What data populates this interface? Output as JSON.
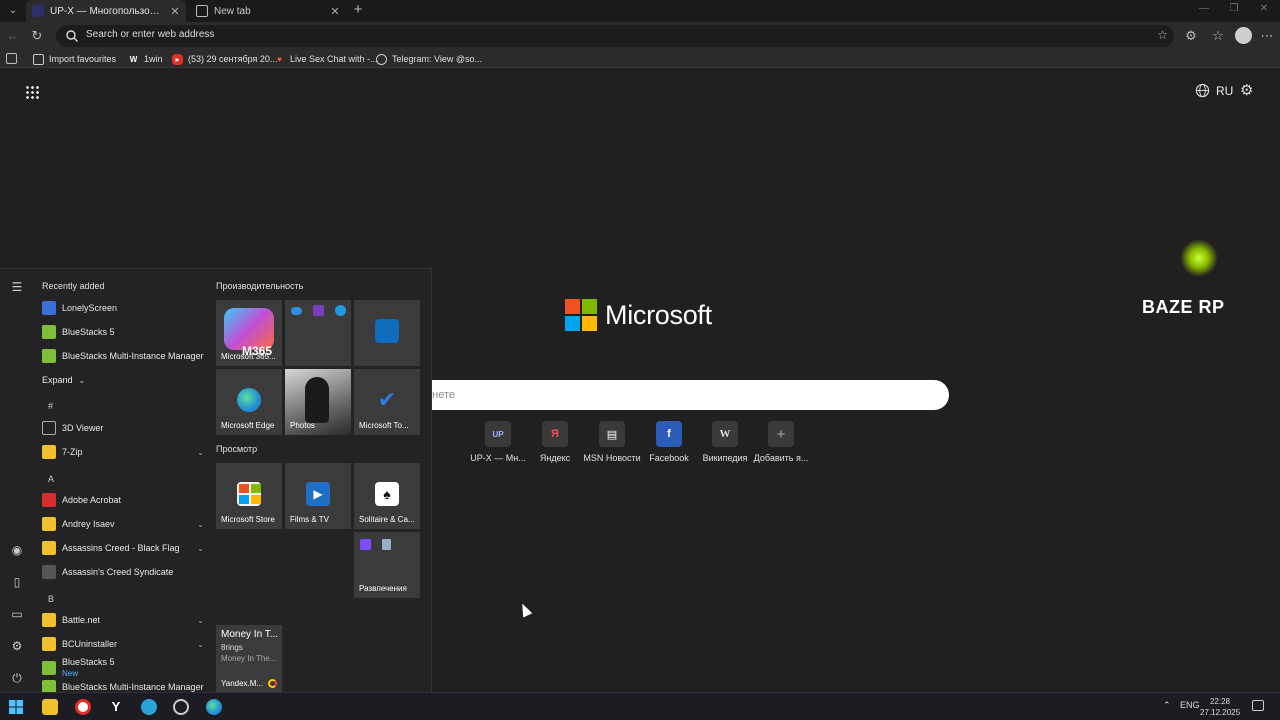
{
  "browser": {
    "tabs": [
      {
        "title": "UP-X — Многопользовательская",
        "favicon": "upx-icon",
        "active": true
      },
      {
        "title": "New tab",
        "favicon": "newtab-icon",
        "active": false
      }
    ],
    "address_placeholder": "Search or enter web address",
    "bookmarks": [
      {
        "label": "Import favourites",
        "icon": "import-icon"
      },
      {
        "label": "1win",
        "icon": "1win-icon"
      },
      {
        "label": "(53) 29 сентября 20...",
        "icon": "youtube-icon"
      },
      {
        "label": "Live Sex Chat with -...",
        "icon": "heart-icon"
      },
      {
        "label": "Telegram: View @so...",
        "icon": "globe-icon"
      }
    ]
  },
  "ntp": {
    "language": "RU",
    "brand": "Microsoft",
    "search_placeholder": "рнете",
    "quick_links": [
      {
        "label": "UP-X — Мн...",
        "glyph": "UP"
      },
      {
        "label": "Яндекс",
        "glyph": "Я"
      },
      {
        "label": "MSN Новости",
        "glyph": "▤"
      },
      {
        "label": "Facebook",
        "glyph": "f"
      },
      {
        "label": "Википедия",
        "glyph": "W"
      },
      {
        "label": "Добавить я...",
        "glyph": "+"
      }
    ],
    "baze_text": "BAZE RP"
  },
  "start_menu": {
    "recently_added_title": "Recently added",
    "recent": [
      {
        "label": "LonelyScreen",
        "color": "#3a6fd8"
      },
      {
        "label": "BlueStacks 5",
        "color": "#7fbf3a"
      },
      {
        "label": "BlueStacks Multi-Instance Manager",
        "color": "#7fbf3a"
      }
    ],
    "expand_label": "Expand",
    "apps": [
      {
        "kind": "letter",
        "label": "#"
      },
      {
        "kind": "app",
        "label": "3D Viewer",
        "color": "#9aa0a6",
        "chev": false
      },
      {
        "kind": "app",
        "label": "7-Zip",
        "color": "#f0c030",
        "chev": true
      },
      {
        "kind": "letter",
        "label": "A"
      },
      {
        "kind": "app",
        "label": "Adobe Acrobat",
        "color": "#d32f2f",
        "chev": false
      },
      {
        "kind": "app",
        "label": "Andrey Isaev",
        "color": "#f0c030",
        "chev": true
      },
      {
        "kind": "app",
        "label": "Assassins Creed - Black Flag",
        "color": "#f0c030",
        "chev": true
      },
      {
        "kind": "app",
        "label": "Assassin's Creed Syndicate",
        "color": "#555555",
        "chev": false
      },
      {
        "kind": "letter",
        "label": "B"
      },
      {
        "kind": "app",
        "label": "Battle.net",
        "color": "#f0c030",
        "chev": true
      },
      {
        "kind": "app",
        "label": "BCUninstaller",
        "color": "#f0c030",
        "chev": true
      },
      {
        "kind": "app",
        "label": "BlueStacks 5",
        "color": "#7fbf3a",
        "chev": false,
        "sub": "New"
      },
      {
        "kind": "app",
        "label": "BlueStacks Multi-Instance Manager",
        "color": "#7fbf3a",
        "chev": false
      }
    ],
    "group1_title": "Производительность",
    "group2_title": "Просмотр",
    "tiles": [
      {
        "label": "Microsoft 365...",
        "badge": "M365",
        "color": "#c04fd6"
      },
      {
        "label": "",
        "color": "#3b3b3b"
      },
      {
        "label": "",
        "color": "#0f6cbd"
      },
      {
        "label": "Microsoft Edge",
        "color": "#1d8fd6"
      },
      {
        "label": "Photos",
        "color": "#777777"
      },
      {
        "label": "Microsoft To...",
        "color": "#2f7de1"
      },
      {
        "label": "Microsoft Store",
        "color": "#2b88d8"
      },
      {
        "label": "Films & TV",
        "color": "#1f6fc5"
      },
      {
        "label": "Solitaire & Ca...",
        "color": "#ffffff"
      },
      {
        "label": "Развлечения",
        "color": "#7c4dff"
      }
    ],
    "money_tile": {
      "title": "Money In T...",
      "line1": "8rings",
      "line2": "Money In The...",
      "footer": "Yandex.M..."
    }
  },
  "taskbar": {
    "lang": "ENG",
    "time": "22:28",
    "date": "27.12.2025"
  }
}
